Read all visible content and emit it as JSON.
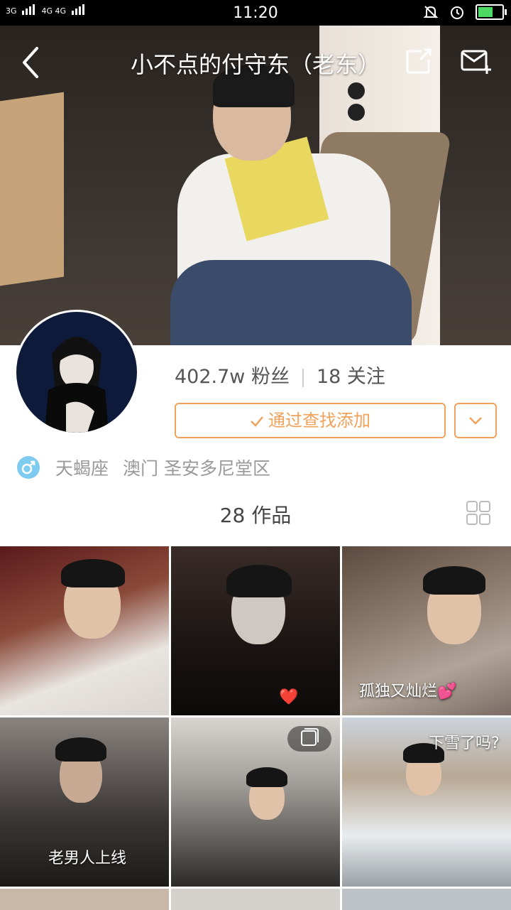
{
  "status_bar": {
    "network_left": "3G",
    "network_right": "4G 4G",
    "time": "11:20"
  },
  "header": {
    "title": "小不点的付守东（老东）",
    "back_icon": "chevron-left-icon",
    "share_icon": "share-icon",
    "message_icon": "add-message-icon"
  },
  "profile": {
    "fans": "402.7w 粉丝",
    "following": "18 关注",
    "follow_button_label": "通过查找添加",
    "gender": "male",
    "constellation": "天蝎座",
    "location": "澳门 圣安多尼堂区",
    "works_count": "28 作品"
  },
  "colors": {
    "accent": "#f0a15a",
    "gender_badge": "#7ecbf0",
    "status_bar_bg": "#000000"
  },
  "grid": {
    "items": [
      {
        "caption": ""
      },
      {
        "caption": "❤️"
      },
      {
        "caption": "孤独又灿烂💕"
      },
      {
        "caption": "老男人上线"
      },
      {
        "caption": ""
      },
      {
        "caption": "下雪了吗?"
      }
    ]
  }
}
